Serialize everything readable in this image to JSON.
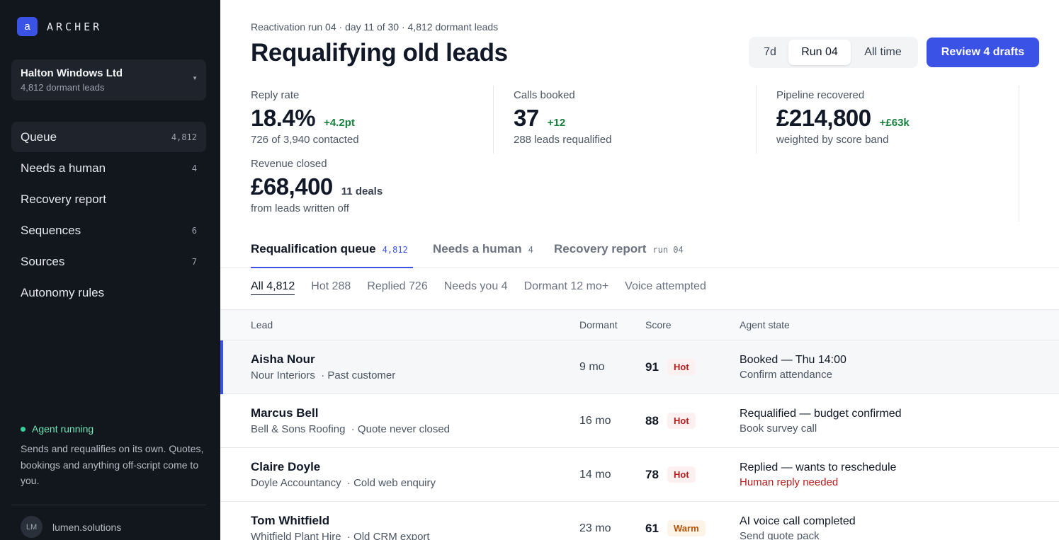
{
  "brand": {
    "mark": "a",
    "name": "ARCHER"
  },
  "workspace": {
    "name": "Halton Windows Ltd",
    "subtitle": "4,812 dormant leads"
  },
  "nav": [
    {
      "label": "Queue",
      "count": "4,812",
      "active": true
    },
    {
      "label": "Needs a human",
      "count": "4"
    },
    {
      "label": "Recovery report",
      "count": ""
    },
    {
      "label": "Sequences",
      "count": "6"
    },
    {
      "label": "Sources",
      "count": "7"
    },
    {
      "label": "Autonomy rules",
      "count": ""
    }
  ],
  "agent": {
    "status": "Agent running",
    "description": "Sends and requalifies on its own. Quotes, bookings and anything off-script come to you."
  },
  "account": {
    "initials": "LM",
    "name": "lumen.solutions"
  },
  "header": {
    "eyebrow": "Reactivation run 04 · day 11 of 30 · 4,812 dormant leads",
    "title": "Requalifying old leads",
    "range_options": [
      "7d",
      "Run 04",
      "All time"
    ],
    "range_selected": "Run 04",
    "primary_action": "Review 4 drafts"
  },
  "kpis": [
    {
      "label": "Reply rate",
      "value": "18.4%",
      "delta": "+4.2pt",
      "sub": "726 of 3,940 contacted"
    },
    {
      "label": "Calls booked",
      "value": "37",
      "delta": "+12",
      "sub": "288 leads requalified"
    },
    {
      "label": "Pipeline recovered",
      "value": "£214,800",
      "delta": "+£63k",
      "sub": "weighted by score band"
    },
    {
      "label": "Revenue closed",
      "value": "£68,400",
      "delta": "11 deals",
      "sub": "from leads written off"
    }
  ],
  "tabs": [
    {
      "label": "Requalification queue",
      "count": "4,812",
      "active": true
    },
    {
      "label": "Needs a human",
      "count": "4"
    },
    {
      "label": "Recovery report",
      "count": "run 04"
    }
  ],
  "filters": [
    "All 4,812",
    "Hot 288",
    "Replied 726",
    "Needs you 4",
    "Dormant 12 mo+",
    "Voice attempted"
  ],
  "table": {
    "columns": [
      "Lead",
      "Dormant",
      "Score",
      "Agent state"
    ],
    "rows": [
      {
        "name": "Aisha Nour",
        "company": "Nour Interiors",
        "source": "· Past customer",
        "dormant": "9 mo",
        "score": "91",
        "band": "Hot",
        "state": "Booked — Thu 14:00",
        "next": "Confirm attendance"
      },
      {
        "name": "Marcus Bell",
        "company": "Bell & Sons Roofing",
        "source": "· Quote never closed",
        "dormant": "16 mo",
        "score": "88",
        "band": "Hot",
        "state": "Requalified — budget confirmed",
        "next": "Book survey call"
      },
      {
        "name": "Claire Doyle",
        "company": "Doyle Accountancy",
        "source": "· Cold web enquiry",
        "dormant": "14 mo",
        "score": "78",
        "band": "Hot",
        "state": "Replied — wants to reschedule",
        "next": "Human reply needed"
      },
      {
        "name": "Tom Whitfield",
        "company": "Whitfield Plant Hire",
        "source": "· Old CRM export",
        "dormant": "23 mo",
        "score": "61",
        "band": "Warm",
        "state": "AI voice call completed",
        "next": "Send quote pack"
      }
    ]
  },
  "colors": {
    "accent": "#3a52e6",
    "positive": "#15803d",
    "alert": "#b91c1c",
    "sidebar": "#12161d"
  }
}
